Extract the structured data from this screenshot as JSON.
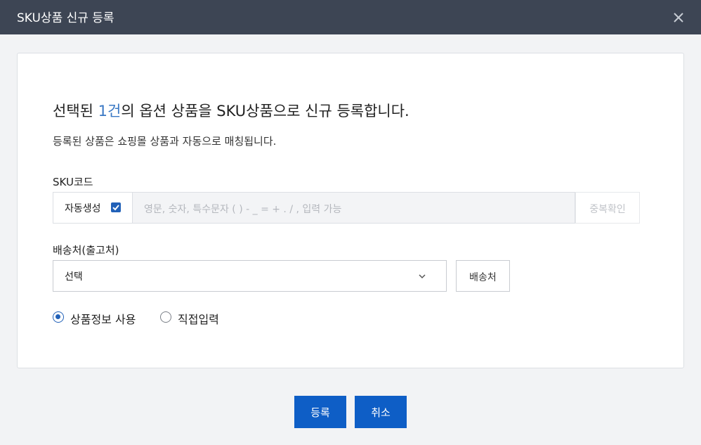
{
  "dialog": {
    "title": "SKU상품 신규 등록",
    "close_icon": "close-icon"
  },
  "intro": {
    "headline_prefix": "선택된 ",
    "headline_count": "1건",
    "headline_suffix": "의 옵션 상품을 SKU상품으로 신규 등록합니다.",
    "subline": "등록된 상품은 쇼핑몰 상품과 자동으로 매칭됩니다."
  },
  "sku_code": {
    "label": "SKU코드",
    "auto_generate_label": "자동생성",
    "auto_generate_checked": true,
    "input_value": "",
    "input_placeholder": "영문, 숫자, 특수문자 ( ) - _ = + . / , 입력 가능",
    "duplicate_check_label": "중복확인"
  },
  "shipping": {
    "label": "배송처(출고처)",
    "selected": "선택",
    "button_label": "배송처"
  },
  "info_source": {
    "options": [
      {
        "label": "상품정보 사용",
        "selected": true
      },
      {
        "label": "직접입력",
        "selected": false
      }
    ]
  },
  "footer": {
    "register_label": "등록",
    "cancel_label": "취소"
  },
  "colors": {
    "titlebar": "#3d4554",
    "accent": "#0e5ec6",
    "highlight_text": "#3a78c4"
  }
}
